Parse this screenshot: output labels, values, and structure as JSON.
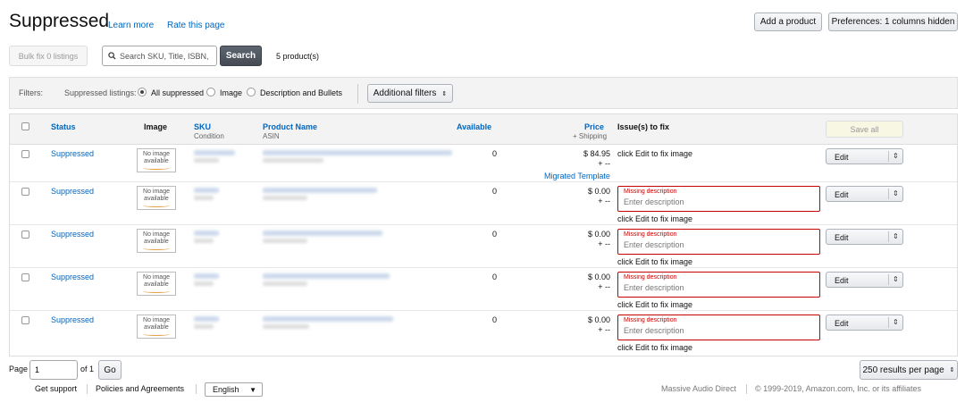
{
  "header": {
    "title": "Suppressed",
    "learn_more": "Learn more",
    "rate_page": "Rate this page",
    "add_product": "Add a product",
    "preferences": "Preferences: 1 columns hidden"
  },
  "toolbar": {
    "bulk_fix": "Bulk fix 0 listings",
    "search_placeholder": "Search SKU, Title, ISBN,",
    "search_button": "Search",
    "product_count": "5 product(s)"
  },
  "filters": {
    "label": "Filters:",
    "group_label": "Suppressed listings:",
    "options": [
      {
        "label": "All suppressed",
        "selected": true
      },
      {
        "label": "Image",
        "selected": false
      },
      {
        "label": "Description and Bullets",
        "selected": false
      }
    ],
    "additional": "Additional filters"
  },
  "table": {
    "columns": {
      "status": "Status",
      "image": "Image",
      "sku": "SKU",
      "sku_sub": "Condition",
      "product_name": "Product Name",
      "product_sub": "ASIN",
      "available": "Available",
      "price": "Price",
      "price_sub": "+ Shipping",
      "issues": "Issue(s) to fix",
      "save_all": "Save all"
    },
    "no_image_text": "No image available",
    "edit_label": "Edit",
    "missing_label": "Missing description",
    "missing_placeholder": "Enter description",
    "rows": [
      {
        "status": "Suppressed",
        "available": "0",
        "price": "$ 84.95",
        "shipping": "+ --",
        "note": "Migrated Template",
        "issue": "click Edit to fix image",
        "missing": false
      },
      {
        "status": "Suppressed",
        "available": "0",
        "price": "$ 0.00",
        "shipping": "+ --",
        "issue": "click Edit to fix image",
        "missing": true
      },
      {
        "status": "Suppressed",
        "available": "0",
        "price": "$ 0.00",
        "shipping": "+ --",
        "issue": "click Edit to fix image",
        "missing": true
      },
      {
        "status": "Suppressed",
        "available": "0",
        "price": "$ 0.00",
        "shipping": "+ --",
        "issue": "click Edit to fix image",
        "missing": true
      },
      {
        "status": "Suppressed",
        "available": "0",
        "price": "$ 0.00",
        "shipping": "+ --",
        "issue": "click Edit to fix image",
        "missing": true
      }
    ]
  },
  "pagination": {
    "page_label": "Page",
    "page_value": "1",
    "of_label": "of 1",
    "go": "Go",
    "per_page": "250 results per page"
  },
  "footer": {
    "support": "Get support",
    "policies": "Policies and Agreements",
    "language": "English",
    "seller": "Massive Audio Direct",
    "copyright": "© 1999-2019, Amazon.com, Inc. or its affiliates"
  }
}
